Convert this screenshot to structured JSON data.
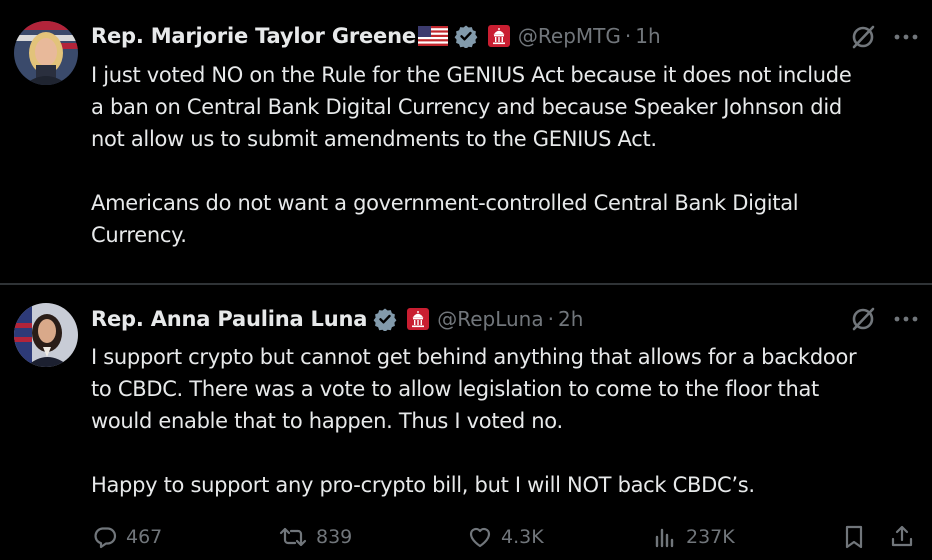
{
  "posts": [
    {
      "display_name": "Rep. Marjorie Taylor Greene",
      "handle": "@RepMTG",
      "separator": "·",
      "time": "1h",
      "paragraphs": [
        [
          "I just voted NO on the Rule for the GENIUS Act because it does not include",
          "a ban on Central Bank Digital Currency and because Speaker Johnson did",
          "not allow us to submit amendments to the GENIUS Act."
        ],
        [
          "Americans do not want a government-controlled Central Bank Digital",
          "Currency."
        ]
      ]
    },
    {
      "display_name": "Rep. Anna Paulina Luna",
      "handle": "@RepLuna",
      "separator": "·",
      "time": "2h",
      "paragraphs": [
        [
          "I support crypto but cannot get behind anything that allows for a backdoor",
          "to CBDC. There was a vote to allow legislation to come to the floor that",
          "would enable that to happen. Thus I voted no."
        ],
        [
          "Happy to support any pro-crypto bill, but I will NOT back CBDC’s."
        ]
      ],
      "actions": {
        "replies": "467",
        "reposts": "839",
        "likes": "4.3K",
        "views": "237K"
      }
    }
  ],
  "colors": {
    "background": "#000000",
    "text": "#e7e9ea",
    "secondary": "#71767b",
    "divider": "#2f3336",
    "verified": "#829aab",
    "gov_badge": "#c91e31"
  },
  "icons": [
    "us-flag-icon",
    "verified-badge-icon",
    "capitol-badge-icon",
    "grok-icon",
    "more-icon",
    "reply-icon",
    "repost-icon",
    "like-icon",
    "views-icon",
    "bookmark-icon",
    "share-icon"
  ]
}
